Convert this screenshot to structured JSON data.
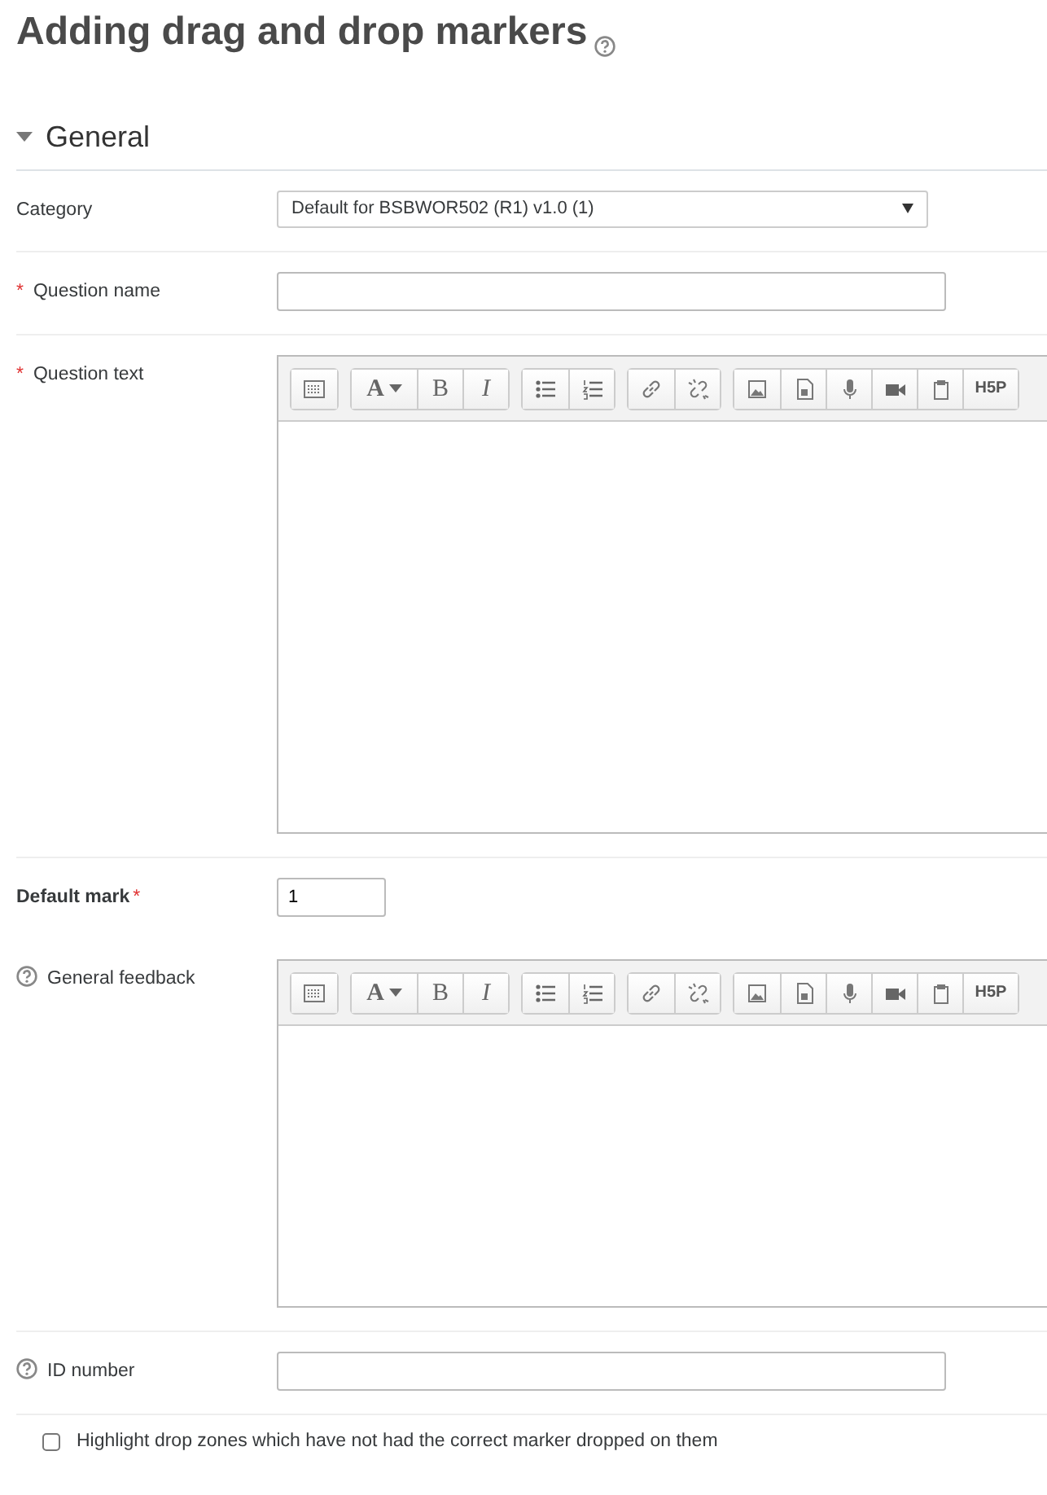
{
  "page_title": "Adding drag and drop markers",
  "section": {
    "title": "General",
    "expanded": true
  },
  "fields": [
    {
      "kind": "select",
      "label": "Category",
      "bold": false,
      "help": false,
      "value": "Default for BSBWOR502 (R1) v1.0 (1)"
    },
    {
      "kind": "text",
      "label": "Question name",
      "required_mark": "*",
      "bold": false,
      "help": false
    },
    {
      "kind": "editor",
      "label": "Question text",
      "required_mark": "*",
      "bold": false,
      "help": false,
      "toolbar": [
        [
          {
            "kind": "collapse"
          }
        ],
        [
          {
            "kind": "font",
            "label": "A"
          },
          {
            "kind": "bold",
            "label": "B"
          },
          {
            "kind": "italic",
            "label": "I"
          }
        ],
        [
          {
            "kind": "bullets"
          },
          {
            "kind": "numbers"
          }
        ],
        [
          {
            "kind": "link"
          },
          {
            "kind": "unlink"
          }
        ],
        [
          {
            "kind": "image"
          },
          {
            "kind": "media"
          },
          {
            "kind": "mic"
          },
          {
            "kind": "video"
          },
          {
            "kind": "paste"
          },
          {
            "kind": "text",
            "label": "H5P"
          }
        ]
      ]
    },
    {
      "kind": "short",
      "label": "Default mark",
      "required_mark": "*",
      "bold": true,
      "help": false,
      "value": "1"
    },
    {
      "kind": "editor",
      "label": "General feedback",
      "bold": false,
      "help": true,
      "toolbar": [
        [
          {
            "kind": "collapse"
          }
        ],
        [
          {
            "kind": "font",
            "label": "A"
          },
          {
            "kind": "bold",
            "label": "B"
          },
          {
            "kind": "italic",
            "label": "I"
          }
        ],
        [
          {
            "kind": "bullets"
          },
          {
            "kind": "numbers"
          }
        ],
        [
          {
            "kind": "link"
          },
          {
            "kind": "unlink"
          }
        ],
        [
          {
            "kind": "image"
          },
          {
            "kind": "media"
          },
          {
            "kind": "mic"
          },
          {
            "kind": "video"
          },
          {
            "kind": "paste"
          },
          {
            "kind": "text",
            "label": "H5P"
          }
        ]
      ]
    },
    {
      "kind": "text",
      "label": "ID number",
      "bold": false,
      "help": true
    }
  ],
  "checkbox": {
    "label": "Highlight drop zones which have not had the correct marker dropped on them",
    "checked": false
  }
}
